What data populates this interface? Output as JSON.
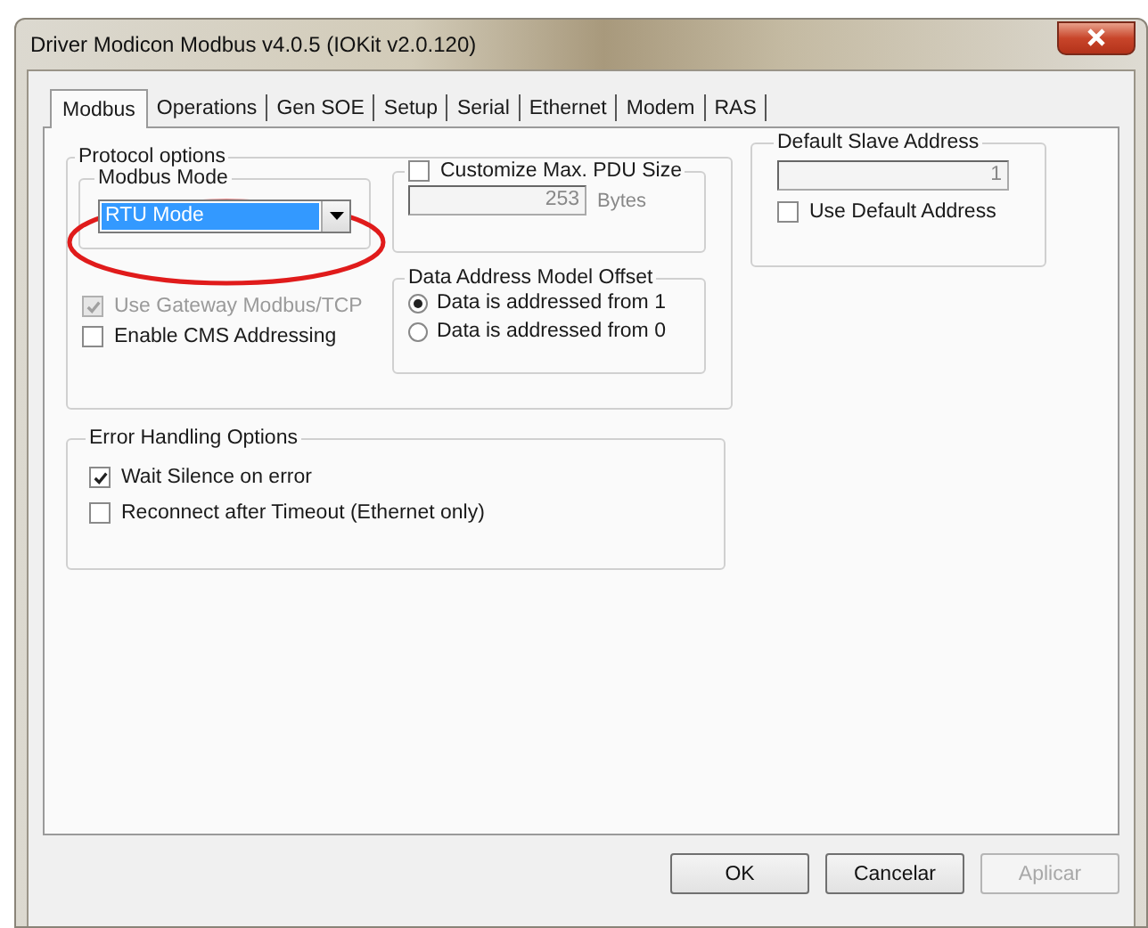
{
  "window": {
    "title": "Driver Modicon Modbus v4.0.5 (IOKit v2.0.120)"
  },
  "tabs": [
    {
      "label": "Modbus",
      "selected": true
    },
    {
      "label": "Operations",
      "selected": false
    },
    {
      "label": "Gen SOE",
      "selected": false
    },
    {
      "label": "Setup",
      "selected": false
    },
    {
      "label": "Serial",
      "selected": false
    },
    {
      "label": "Ethernet",
      "selected": false
    },
    {
      "label": "Modem",
      "selected": false
    },
    {
      "label": "RAS",
      "selected": false
    }
  ],
  "protocol_options": {
    "title": "Protocol options",
    "modbus_mode": {
      "title": "Modbus Mode",
      "value": "RTU Mode",
      "highlighted": true
    },
    "max_pdu": {
      "label": "Customize Max. PDU Size",
      "checked": false,
      "value": "253",
      "unit": "Bytes"
    },
    "gateway": {
      "label": "Use Gateway Modbus/TCP",
      "checked": true,
      "disabled": true
    },
    "cms": {
      "label": "Enable CMS Addressing",
      "checked": false,
      "disabled": false
    },
    "data_address": {
      "title": "Data Address Model Offset",
      "options": [
        {
          "label": "Data is addressed from 1",
          "selected": true
        },
        {
          "label": "Data is addressed from 0",
          "selected": false
        }
      ]
    }
  },
  "default_slave": {
    "title": "Default Slave Address",
    "value": "1",
    "use_default": {
      "label": "Use Default Address",
      "checked": false,
      "disabled": false
    }
  },
  "error_handling": {
    "title": "Error Handling Options",
    "options": [
      {
        "label": "Wait Silence on error",
        "checked": true,
        "disabled": false
      },
      {
        "label": "Reconnect after Timeout (Ethernet only)",
        "checked": false,
        "disabled": false
      }
    ]
  },
  "buttons": [
    {
      "label": "OK",
      "disabled": false
    },
    {
      "label": "Cancelar",
      "disabled": false
    },
    {
      "label": "Aplicar",
      "disabled": true
    }
  ]
}
